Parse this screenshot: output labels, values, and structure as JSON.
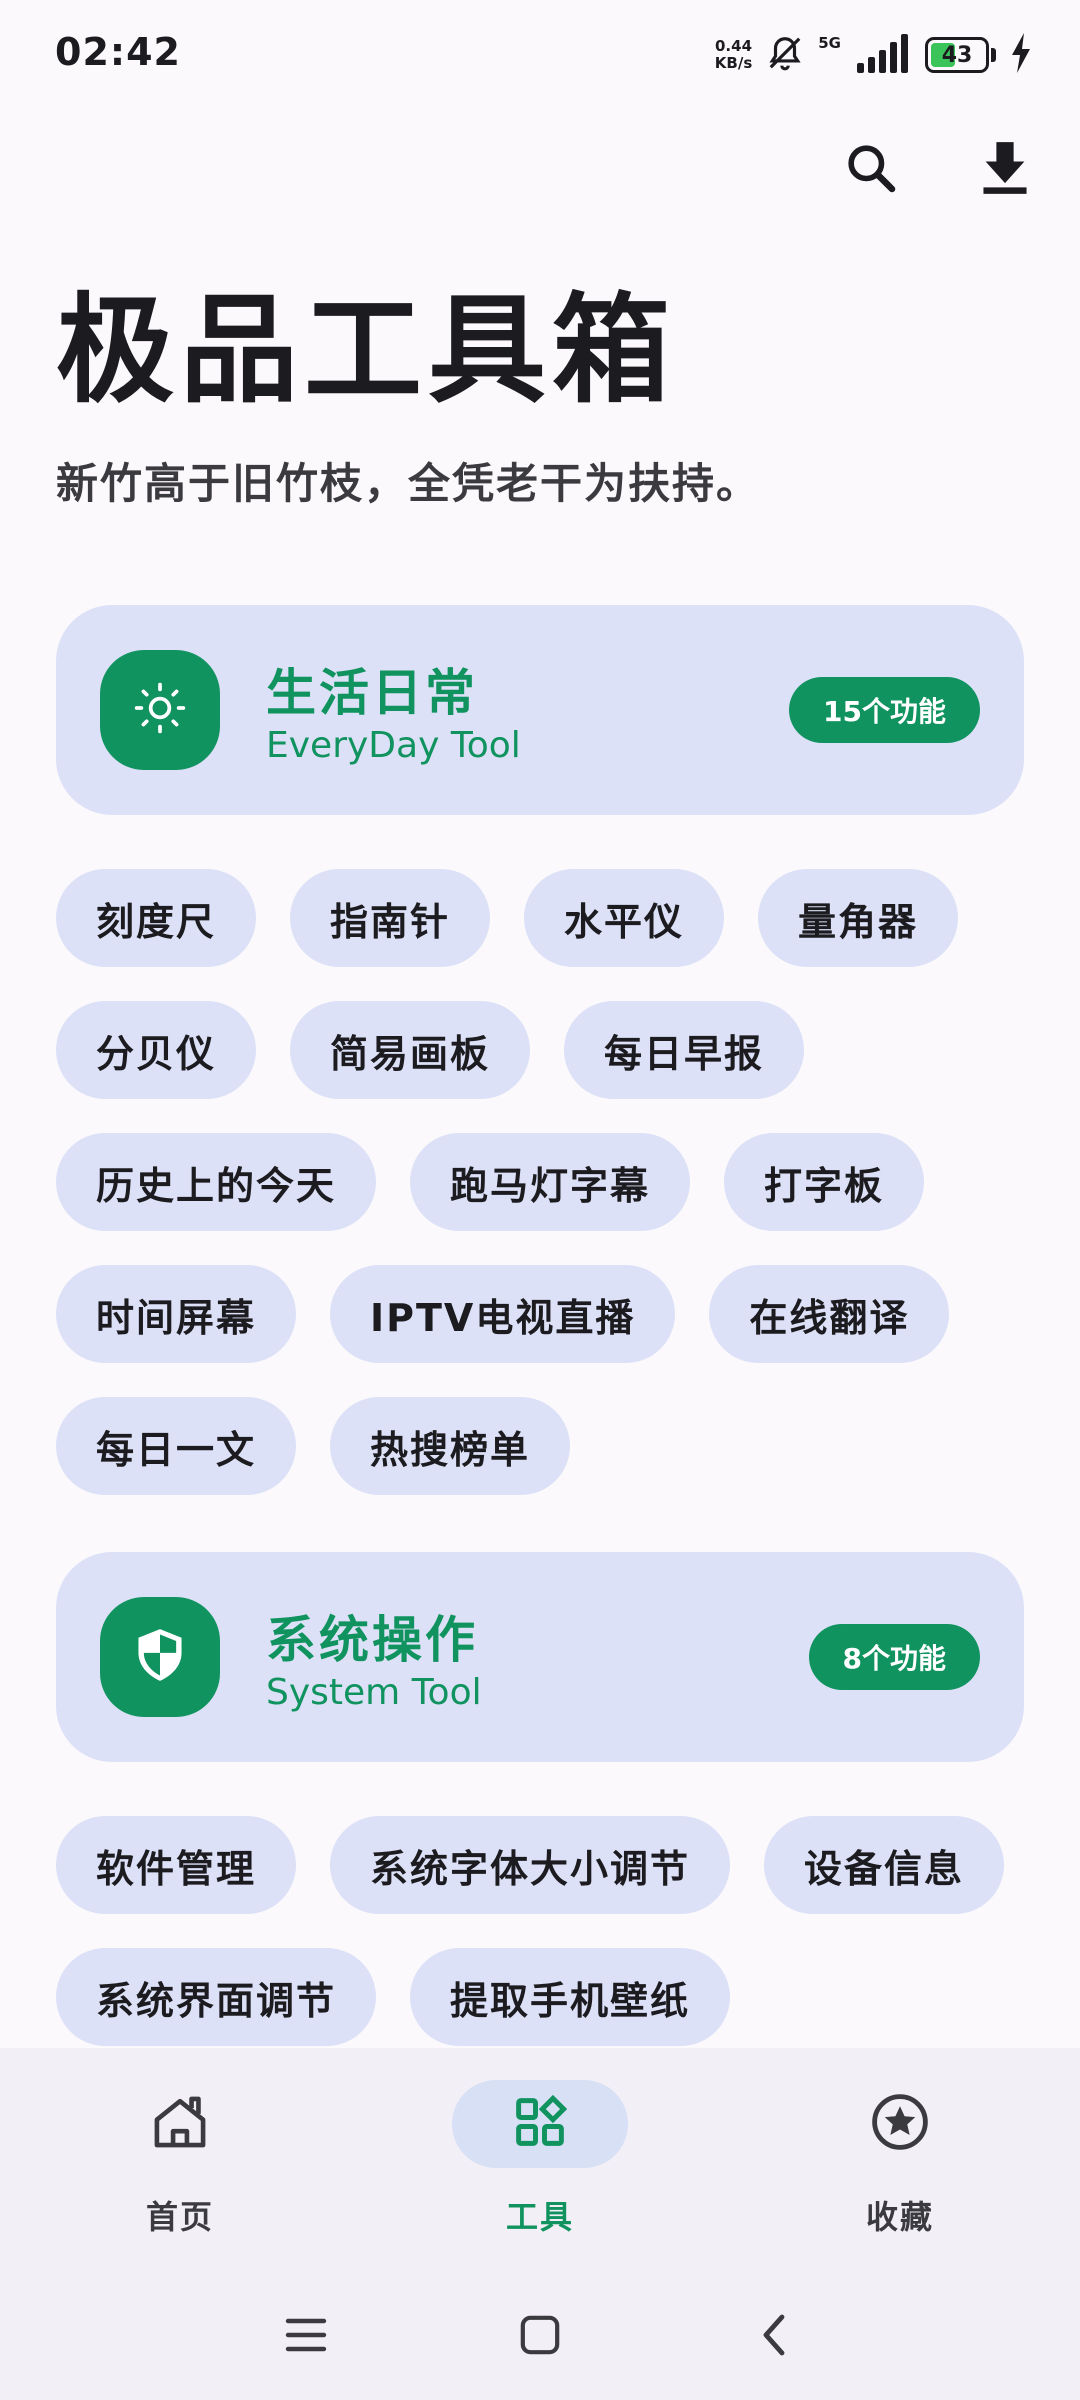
{
  "status_bar": {
    "time": "02:42",
    "net_speed_value": "0.44",
    "net_speed_unit": "KB/s",
    "network_type": "5G",
    "battery_level": "43"
  },
  "header": {
    "title": "极品工具箱",
    "subtitle": "新竹高于旧竹枝，全凭老干为扶持。"
  },
  "categories": [
    {
      "title": "生活日常",
      "subtitle": "EveryDay Tool",
      "badge": "15个功能",
      "icon": "sun-icon",
      "tools": [
        "刻度尺",
        "指南针",
        "水平仪",
        "量角器",
        "分贝仪",
        "简易画板",
        "每日早报",
        "历史上的今天",
        "跑马灯字幕",
        "打字板",
        "时间屏幕",
        "IPTV电视直播",
        "在线翻译",
        "每日一文",
        "热搜榜单"
      ]
    },
    {
      "title": "系统操作",
      "subtitle": "System Tool",
      "badge": "8个功能",
      "icon": "shield-icon",
      "tools": [
        "软件管理",
        "系统字体大小调节",
        "设备信息",
        "系统界面调节",
        "提取手机壁纸"
      ]
    }
  ],
  "bottom_nav": {
    "items": [
      {
        "label": "首页",
        "icon": "home-icon",
        "active": false
      },
      {
        "label": "工具",
        "icon": "grid-icon",
        "active": true
      },
      {
        "label": "收藏",
        "icon": "star-icon",
        "active": false
      }
    ]
  },
  "colors": {
    "accent": "#10935f",
    "card_bg": "#dce1f7",
    "page_bg": "#fcf9fc"
  }
}
